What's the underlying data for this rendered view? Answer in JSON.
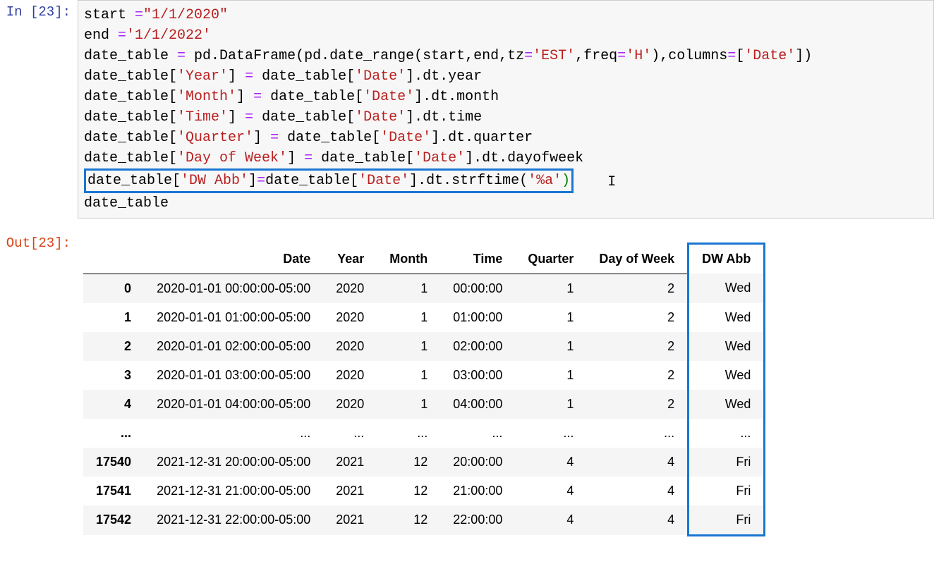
{
  "prompts": {
    "in": "In [23]:",
    "out": "Out[23]:"
  },
  "code": {
    "l1_a": "start ",
    "l1_b": "=",
    "l1_c": "\"1/1/2020\"",
    "l2_a": "end ",
    "l2_b": "=",
    "l2_c": "'1/1/2022'",
    "l3_a": "date_table ",
    "l3_b": "=",
    "l3_c": " pd.DataFrame(pd.date_range(start,end,tz",
    "l3_d": "=",
    "l3_e": "'EST'",
    "l3_f": ",freq",
    "l3_g": "=",
    "l3_h": "'H'",
    "l3_i": "),columns",
    "l3_j": "=",
    "l3_k": "[",
    "l3_l": "'Date'",
    "l3_m": "])",
    "l4_a": "date_table[",
    "l4_b": "'Year'",
    "l4_c": "] ",
    "l4_d": "=",
    "l4_e": " date_table[",
    "l4_f": "'Date'",
    "l4_g": "].dt.year",
    "l5_a": "date_table[",
    "l5_b": "'Month'",
    "l5_c": "] ",
    "l5_d": "=",
    "l5_e": " date_table[",
    "l5_f": "'Date'",
    "l5_g": "].dt.month",
    "l6_a": "date_table[",
    "l6_b": "'Time'",
    "l6_c": "] ",
    "l6_d": "=",
    "l6_e": " date_table[",
    "l6_f": "'Date'",
    "l6_g": "].dt.time",
    "l7_a": "date_table[",
    "l7_b": "'Quarter'",
    "l7_c": "] ",
    "l7_d": "=",
    "l7_e": " date_table[",
    "l7_f": "'Date'",
    "l7_g": "].dt.quarter",
    "l8_a": "date_table[",
    "l8_b": "'Day of Week'",
    "l8_c": "] ",
    "l8_d": "=",
    "l8_e": " date_table[",
    "l8_f": "'Date'",
    "l8_g": "].dt.dayofweek",
    "l9_a": "date_table[",
    "l9_b": "'DW Abb'",
    "l9_c": "]",
    "l9_d": "=",
    "l9_e": "date_table[",
    "l9_f": "'Date'",
    "l9_g": "].dt.strftime(",
    "l9_h": "'%a'",
    "l9_i": ")",
    "l10_a": "date_table",
    "cursor": "I"
  },
  "table": {
    "headers": [
      "",
      "Date",
      "Year",
      "Month",
      "Time",
      "Quarter",
      "Day of Week",
      "DW Abb"
    ],
    "rows": [
      {
        "idx": "0",
        "Date": "2020-01-01 00:00:00-05:00",
        "Year": "2020",
        "Month": "1",
        "Time": "00:00:00",
        "Quarter": "1",
        "DayOfWeek": "2",
        "DWAbb": "Wed"
      },
      {
        "idx": "1",
        "Date": "2020-01-01 01:00:00-05:00",
        "Year": "2020",
        "Month": "1",
        "Time": "01:00:00",
        "Quarter": "1",
        "DayOfWeek": "2",
        "DWAbb": "Wed"
      },
      {
        "idx": "2",
        "Date": "2020-01-01 02:00:00-05:00",
        "Year": "2020",
        "Month": "1",
        "Time": "02:00:00",
        "Quarter": "1",
        "DayOfWeek": "2",
        "DWAbb": "Wed"
      },
      {
        "idx": "3",
        "Date": "2020-01-01 03:00:00-05:00",
        "Year": "2020",
        "Month": "1",
        "Time": "03:00:00",
        "Quarter": "1",
        "DayOfWeek": "2",
        "DWAbb": "Wed"
      },
      {
        "idx": "4",
        "Date": "2020-01-01 04:00:00-05:00",
        "Year": "2020",
        "Month": "1",
        "Time": "04:00:00",
        "Quarter": "1",
        "DayOfWeek": "2",
        "DWAbb": "Wed"
      },
      {
        "idx": "...",
        "Date": "...",
        "Year": "...",
        "Month": "...",
        "Time": "...",
        "Quarter": "...",
        "DayOfWeek": "...",
        "DWAbb": "..."
      },
      {
        "idx": "17540",
        "Date": "2021-12-31 20:00:00-05:00",
        "Year": "2021",
        "Month": "12",
        "Time": "20:00:00",
        "Quarter": "4",
        "DayOfWeek": "4",
        "DWAbb": "Fri"
      },
      {
        "idx": "17541",
        "Date": "2021-12-31 21:00:00-05:00",
        "Year": "2021",
        "Month": "12",
        "Time": "21:00:00",
        "Quarter": "4",
        "DayOfWeek": "4",
        "DWAbb": "Fri"
      },
      {
        "idx": "17542",
        "Date": "2021-12-31 22:00:00-05:00",
        "Year": "2021",
        "Month": "12",
        "Time": "22:00:00",
        "Quarter": "4",
        "DayOfWeek": "4",
        "DWAbb": "Fri"
      }
    ]
  }
}
